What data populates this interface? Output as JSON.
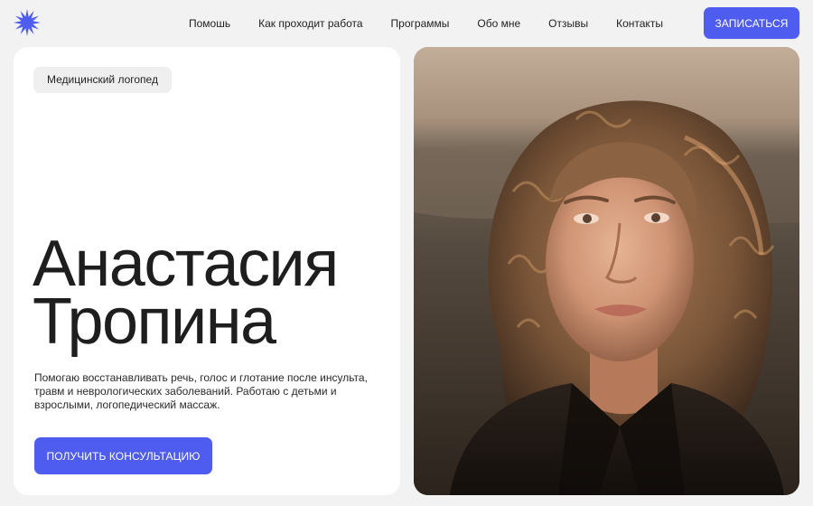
{
  "header": {
    "logo_icon": "starburst-icon",
    "nav": [
      {
        "label": "Помошь"
      },
      {
        "label": "Как проходит работа"
      },
      {
        "label": "Программы"
      },
      {
        "label": "Обо мне"
      },
      {
        "label": "Отзывы"
      },
      {
        "label": "Контакты"
      }
    ],
    "cta_label": "ЗАПИСАТЬСЯ"
  },
  "hero": {
    "badge": "Медицинский логопед",
    "name_line1": "Анастасия",
    "name_line2": "Тропина",
    "description": "Помогаю восстанавливать речь, голос и глотание после инсульта, травм и неврологических заболеваний. Работаю с детьми и взрослыми, логопедический массаж.",
    "cta_label": "ПОЛУЧИТЬ КОНСУЛЬТАЦИЮ"
  },
  "portrait": {
    "icon": "portrait-photo"
  },
  "colors": {
    "accent": "#4f5cf0",
    "background": "#f2f2f2",
    "card": "#ffffff",
    "chip": "#efefef",
    "text": "#1f1f1f"
  }
}
